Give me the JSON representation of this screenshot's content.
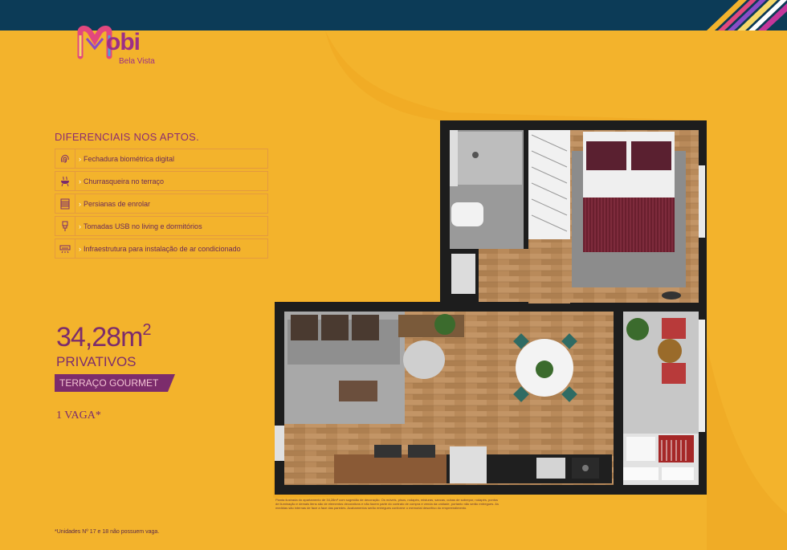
{
  "brand": {
    "name": "obi",
    "sub": "Bela Vista"
  },
  "features": {
    "title": "DIFERENCIAIS NOS APTOS.",
    "items": [
      {
        "icon": "fingerprint-icon",
        "label": "Fechadura biométrica digital"
      },
      {
        "icon": "grill-icon",
        "label": "Churrasqueira no terraço"
      },
      {
        "icon": "blinds-icon",
        "label": "Persianas de enrolar"
      },
      {
        "icon": "usb-plug-icon",
        "label": "Tomadas USB no living e dormitórios"
      },
      {
        "icon": "air-conditioner-icon",
        "label": "Infraestrutura para instalação de ar condicionado"
      }
    ]
  },
  "unit": {
    "area": "34,28m",
    "area_sup": "2",
    "privativos": "PRIVATIVOS",
    "badge": "TERRAÇO GOURMET",
    "vaga": "1 VAGA*"
  },
  "plan_note": "Planta ilustrada do apartamento de 34,28m² com sugestão de decoração. Os móveis, pisos, rodapés, misturas, sancas, cubas de sobrepor, rodapés, pontos de iluminação e demais itens são de elementos decorativos e não fazem parte do contrato de compra e venda da unidade, portanto não serão entregues. As medidas são internas de face a face das paredes. Acabamentos serão entregues conforme o memorial descritivo do empreendimento.",
  "footnote": "*Unidades Nº 17 e 18 não possuem vaga.",
  "colors": {
    "background": "#f3b32c",
    "topbar": "#0c3b57",
    "accent": "#7c2c6c"
  }
}
